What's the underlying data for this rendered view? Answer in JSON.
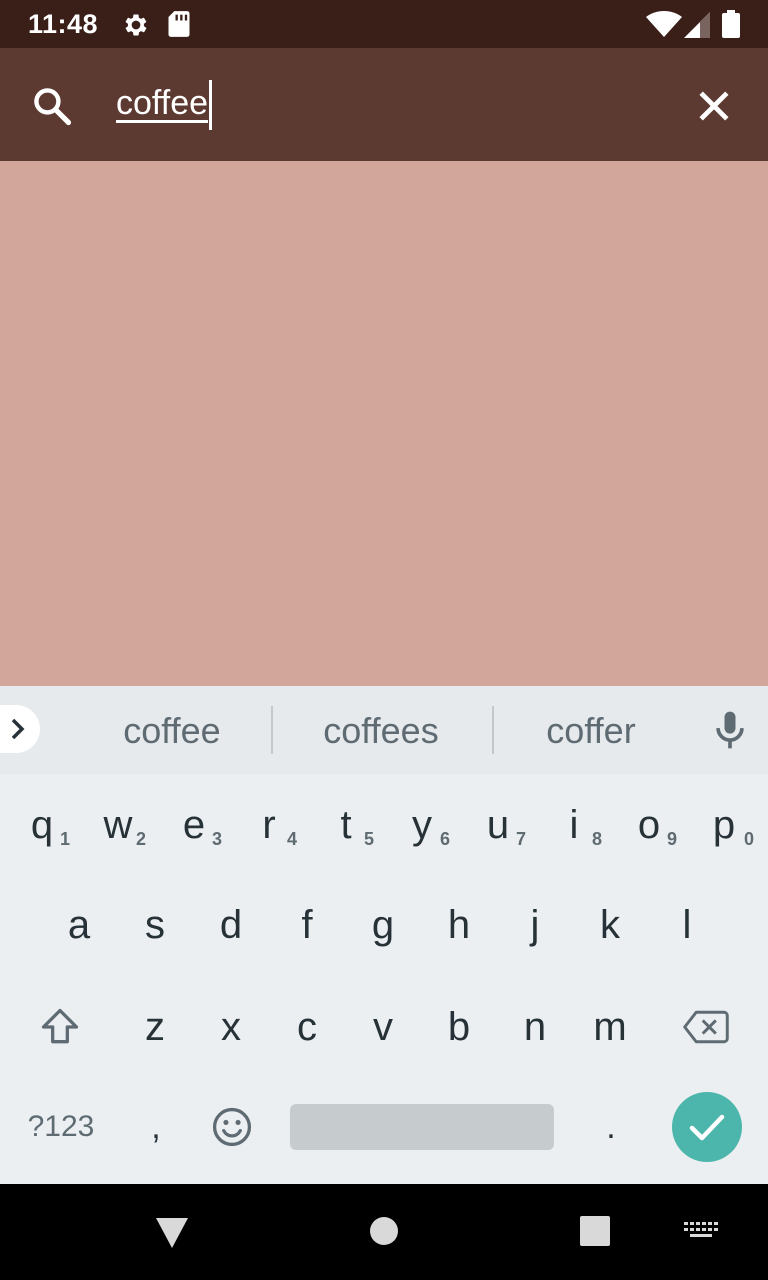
{
  "status_bar": {
    "time": "11:48"
  },
  "search": {
    "query": "coffee"
  },
  "keyboard": {
    "suggestions": [
      "coffee",
      "coffees",
      "coffer"
    ],
    "row1": [
      {
        "k": "q",
        "h": "1"
      },
      {
        "k": "w",
        "h": "2"
      },
      {
        "k": "e",
        "h": "3"
      },
      {
        "k": "r",
        "h": "4"
      },
      {
        "k": "t",
        "h": "5"
      },
      {
        "k": "y",
        "h": "6"
      },
      {
        "k": "u",
        "h": "7"
      },
      {
        "k": "i",
        "h": "8"
      },
      {
        "k": "o",
        "h": "9"
      },
      {
        "k": "p",
        "h": "0"
      }
    ],
    "row2": [
      "a",
      "s",
      "d",
      "f",
      "g",
      "h",
      "j",
      "k",
      "l"
    ],
    "row3": [
      "z",
      "x",
      "c",
      "v",
      "b",
      "n",
      "m"
    ],
    "symbols_key": "?123",
    "comma_key": ",",
    "period_key": ".",
    "enter_color": "#4db6ac"
  },
  "colors": {
    "status_bar": "#3a1f19",
    "app_bar": "#5d3a31",
    "background": "#d2a69b"
  }
}
